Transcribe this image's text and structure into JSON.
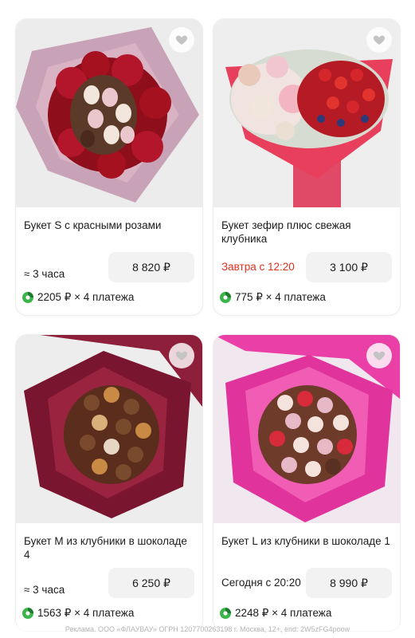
{
  "products": [
    {
      "title": "Букет S с красными розами",
      "delivery": "≈ 3 часа",
      "price": "8 820 ₽",
      "installment": "2205 ₽ × 4 платежа"
    },
    {
      "title": "Букет зефир плюс свежая клубника",
      "delivery": "Завтра с 12:20",
      "price": "3 100 ₽",
      "installment": "775 ₽ × 4 платежа"
    },
    {
      "title": "Букет M из клубники в шоколаде 4",
      "delivery": "≈ 3 часа",
      "price": "6 250 ₽",
      "installment": "1563 ₽ × 4 платежа"
    },
    {
      "title": "Букет L из клубники в шоколаде 1",
      "delivery": "Сегодня с 20:20",
      "price": "8 990 ₽",
      "installment": "2248 ₽ × 4 платежа"
    }
  ],
  "ad_disclaimer": "Реклама. ООО «ФЛАУВАУ» ОГРН 1207700263198 г. Москва, 12+, erid: 2W5zFG4poow",
  "icons": {
    "favorite": "heart-icon",
    "installment": "split-payment-icon"
  },
  "colors": {
    "delivery_tomorrow": "#e0301e",
    "price_bg": "#f2f2f2",
    "split_icon": "#3bb54a"
  }
}
